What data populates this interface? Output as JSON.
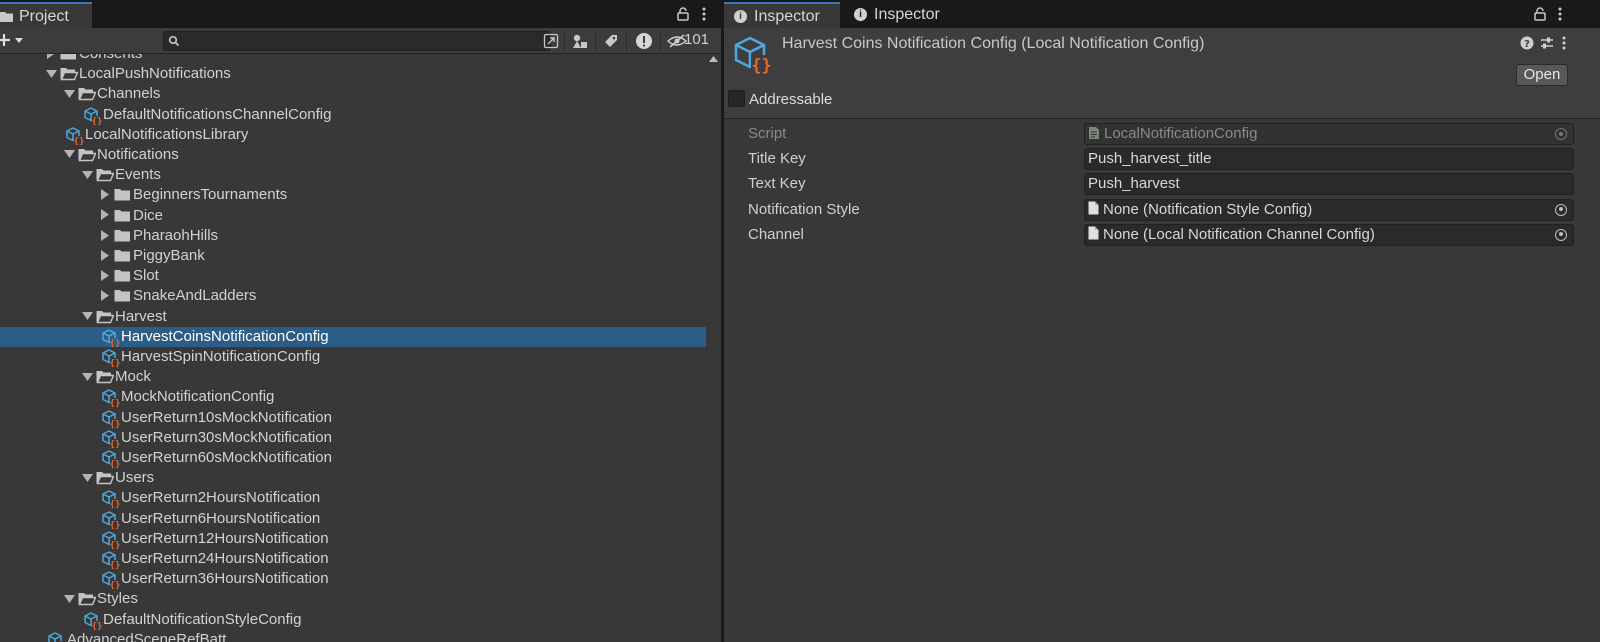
{
  "project_panel": {
    "tab_label": "Project",
    "hidden_count": "101",
    "tree": [
      {
        "label": "Consents",
        "depth": 0,
        "kind": "folder",
        "arrow": "right",
        "clipped": true
      },
      {
        "label": "LocalPushNotifications",
        "depth": 0,
        "kind": "folder-open",
        "arrow": "down"
      },
      {
        "label": "Channels",
        "depth": 1,
        "kind": "folder-open",
        "arrow": "down"
      },
      {
        "label": "DefaultNotificationsChannelConfig",
        "depth": 2,
        "kind": "asset",
        "arrow": ""
      },
      {
        "label": "LocalNotificationsLibrary",
        "depth": 1,
        "kind": "asset",
        "arrow": ""
      },
      {
        "label": "Notifications",
        "depth": 1,
        "kind": "folder-open",
        "arrow": "down"
      },
      {
        "label": "Events",
        "depth": 2,
        "kind": "folder-open",
        "arrow": "down"
      },
      {
        "label": "BeginnersTournaments",
        "depth": 3,
        "kind": "folder",
        "arrow": "right"
      },
      {
        "label": "Dice",
        "depth": 3,
        "kind": "folder",
        "arrow": "right"
      },
      {
        "label": "PharaohHills",
        "depth": 3,
        "kind": "folder",
        "arrow": "right"
      },
      {
        "label": "PiggyBank",
        "depth": 3,
        "kind": "folder",
        "arrow": "right"
      },
      {
        "label": "Slot",
        "depth": 3,
        "kind": "folder",
        "arrow": "right"
      },
      {
        "label": "SnakeAndLadders",
        "depth": 3,
        "kind": "folder",
        "arrow": "right"
      },
      {
        "label": "Harvest",
        "depth": 2,
        "kind": "folder-open",
        "arrow": "down"
      },
      {
        "label": "HarvestCoinsNotificationConfig",
        "depth": 3,
        "kind": "asset",
        "arrow": "",
        "selected": true
      },
      {
        "label": "HarvestSpinNotificationConfig",
        "depth": 3,
        "kind": "asset",
        "arrow": ""
      },
      {
        "label": "Mock",
        "depth": 2,
        "kind": "folder-open",
        "arrow": "down"
      },
      {
        "label": "MockNotificationConfig",
        "depth": 3,
        "kind": "asset",
        "arrow": ""
      },
      {
        "label": "UserReturn10sMockNotification",
        "depth": 3,
        "kind": "asset",
        "arrow": ""
      },
      {
        "label": "UserReturn30sMockNotification",
        "depth": 3,
        "kind": "asset",
        "arrow": ""
      },
      {
        "label": "UserReturn60sMockNotification",
        "depth": 3,
        "kind": "asset",
        "arrow": ""
      },
      {
        "label": "Users",
        "depth": 2,
        "kind": "folder-open",
        "arrow": "down"
      },
      {
        "label": "UserReturn2HoursNotification",
        "depth": 3,
        "kind": "asset",
        "arrow": ""
      },
      {
        "label": "UserReturn6HoursNotification",
        "depth": 3,
        "kind": "asset",
        "arrow": ""
      },
      {
        "label": "UserReturn12HoursNotification",
        "depth": 3,
        "kind": "asset",
        "arrow": ""
      },
      {
        "label": "UserReturn24HoursNotification",
        "depth": 3,
        "kind": "asset",
        "arrow": ""
      },
      {
        "label": "UserReturn36HoursNotification",
        "depth": 3,
        "kind": "asset",
        "arrow": ""
      },
      {
        "label": "Styles",
        "depth": 1,
        "kind": "folder-open",
        "arrow": "down"
      },
      {
        "label": "DefaultNotificationStyleConfig",
        "depth": 2,
        "kind": "asset",
        "arrow": ""
      },
      {
        "label": "AdvancedSceneRefBatt...",
        "depth": 0,
        "kind": "asset",
        "arrow": "",
        "clipped": true
      }
    ]
  },
  "inspector": {
    "tabs": [
      "Inspector",
      "Inspector"
    ],
    "title": "Harvest Coins Notification Config (Local Notification Config)",
    "open_button": "Open",
    "addressable_label": "Addressable",
    "properties": [
      {
        "label": "Script",
        "value": "LocalNotificationConfig",
        "disabled": true,
        "icon": "script"
      },
      {
        "label": "Title Key",
        "value": "Push_harvest_title"
      },
      {
        "label": "Text Key",
        "value": "Push_harvest"
      },
      {
        "label": "Notification Style",
        "value": "None (Notification Style Config)",
        "icon": "doc"
      },
      {
        "label": "Channel",
        "value": "None (Local Notification Channel Config)",
        "icon": "doc"
      }
    ]
  },
  "colors": {
    "selection": "#2c5d87",
    "asset_blue": "#4ea8e0",
    "asset_orange": "#e8662b",
    "tab_accent": "#3a79bb"
  }
}
